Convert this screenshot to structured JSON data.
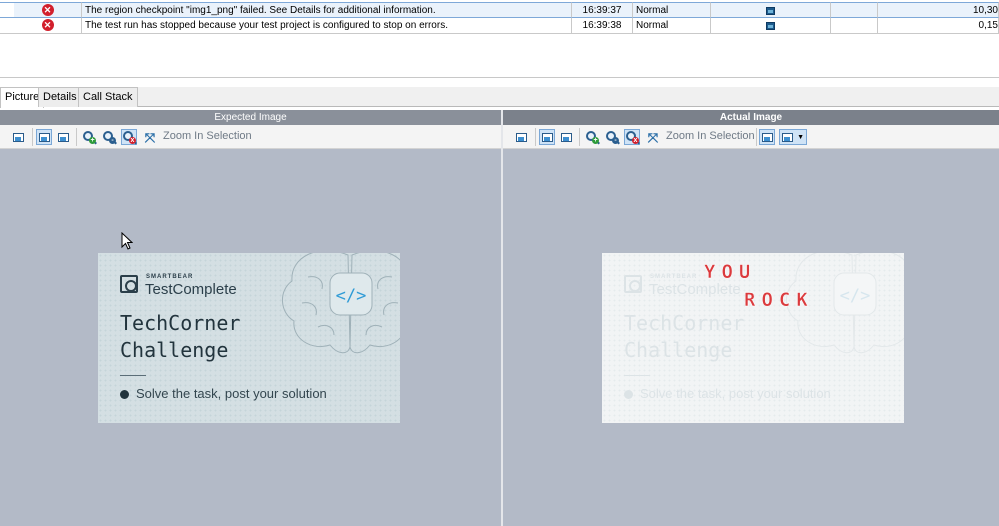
{
  "log": {
    "rows": [
      {
        "message": "The region checkpoint \"img1_png\" failed. See Details for additional information.",
        "time": "16:39:37",
        "priority": "Normal",
        "value": "10,30",
        "selected": true
      },
      {
        "message": "The test run has stopped because your test project is configured to stop on errors.",
        "time": "16:39:38",
        "priority": "Normal",
        "value": "0,15",
        "selected": false
      }
    ]
  },
  "tabs": [
    "Picture",
    "Details",
    "Call Stack"
  ],
  "active_tab": "Picture",
  "panes": {
    "expected": {
      "title": "Expected Image",
      "zoom_label": "Zoom In Selection"
    },
    "actual": {
      "title": "Actual Image",
      "zoom_label": "Zoom In Selection"
    }
  },
  "banner": {
    "brand_small": "SMARTBEAR",
    "brand_name": "TestComplete",
    "title": "TechCorner\nChallenge",
    "subtitle": "Solve the task, post your solution",
    "code_symbol": "</>"
  },
  "actual_overlay": {
    "line1": "YOU",
    "line2": "ROCK"
  },
  "colors": {
    "error": "#d21f2c",
    "pane_bg": "#b3bac7",
    "overlay_text": "#d9262a"
  }
}
